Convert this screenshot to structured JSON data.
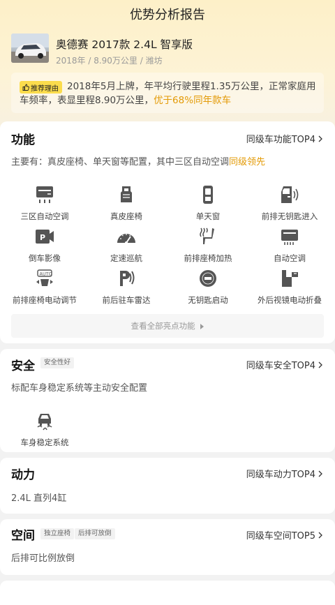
{
  "header": {
    "title": "优势分析报告"
  },
  "car": {
    "name": "奥德赛 2017款 2.4L 智享版",
    "meta": "2018年 / 8.90万公里 / 潍坊"
  },
  "reason": {
    "tag": "推荐理由",
    "text": "2018年5月上牌，年平均行驶里程1.35万公里，正常家庭用车频率，表显里程8.90万公里，",
    "highlight": "优于68%同年款车"
  },
  "function_card": {
    "title": "功能",
    "rank": "同级车功能TOP4",
    "desc_prefix": "主要有：真皮座椅、单天窗等配置，其中三区自动空调",
    "desc_highlight": "同级领先",
    "features": [
      {
        "label": "三区自动空调",
        "icon": "tri-zone-ac-icon"
      },
      {
        "label": "真皮座椅",
        "icon": "leather-seat-icon"
      },
      {
        "label": "单天窗",
        "icon": "sunroof-icon"
      },
      {
        "label": "前排无钥匙进入",
        "icon": "keyless-entry-icon"
      },
      {
        "label": "倒车影像",
        "icon": "reverse-camera-icon"
      },
      {
        "label": "定速巡航",
        "icon": "cruise-control-icon"
      },
      {
        "label": "前排座椅加热",
        "icon": "seat-heating-icon"
      },
      {
        "label": "自动空调",
        "icon": "auto-ac-icon"
      },
      {
        "label": "前排座椅电动调节",
        "icon": "power-seat-icon"
      },
      {
        "label": "前后驻车雷达",
        "icon": "parking-radar-icon"
      },
      {
        "label": "无钥匙启动",
        "icon": "keyless-start-icon"
      },
      {
        "label": "外后视镜电动折叠",
        "icon": "mirror-fold-icon"
      }
    ],
    "view_all": "查看全部亮点功能"
  },
  "safety_card": {
    "title": "安全",
    "badge": "安全性好",
    "rank": "同级车安全TOP4",
    "desc": "标配车身稳定系统等主动安全配置",
    "features": [
      {
        "label": "车身稳定系统",
        "icon": "stability-control-icon"
      }
    ]
  },
  "power_card": {
    "title": "动力",
    "rank": "同级车动力TOP4",
    "desc": "2.4L 直列4缸"
  },
  "space_card": {
    "title": "空间",
    "badges": [
      "独立座椅",
      "后排可放倒"
    ],
    "rank": "同级车空间TOP5",
    "desc": "后排可比例放倒"
  },
  "colors": {
    "accent": "#e39a06",
    "tag_bg": "#fbdc4c",
    "hero_bg": "#fdf0c8",
    "icon": "#555555"
  }
}
